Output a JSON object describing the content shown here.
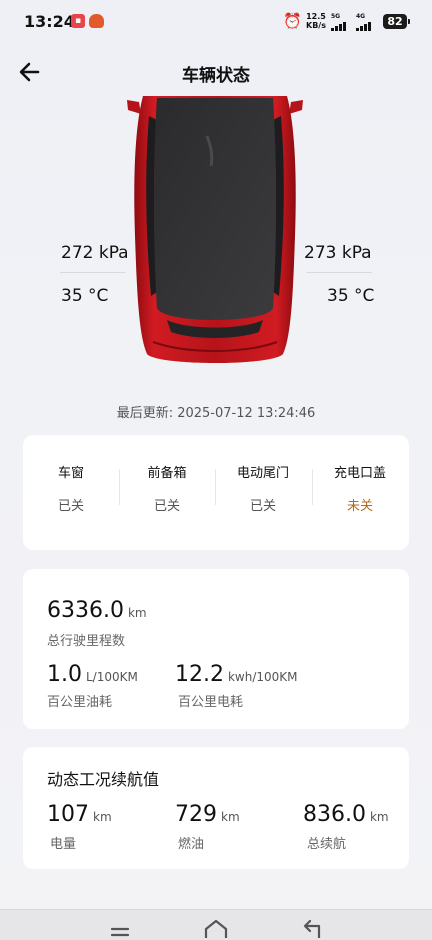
{
  "status_bar": {
    "time": "13:24",
    "net_speed_value": "12.5",
    "net_speed_unit": "KB/s",
    "signal1_label": "5G",
    "signal2_label": "4G",
    "battery": "82"
  },
  "header": {
    "title": "车辆状态"
  },
  "tires": {
    "left_pressure": "272 kPa",
    "left_temp": "35 °C",
    "right_pressure": "273 kPa",
    "right_temp": "35 °C"
  },
  "last_update": "最后更新:  2025-07-12 13:24:46",
  "status_items": [
    {
      "name": "车窗",
      "value": "已关"
    },
    {
      "name": "前备箱",
      "value": "已关"
    },
    {
      "name": "电动尾门",
      "value": "已关"
    },
    {
      "name": "充电口盖",
      "value": "未关"
    }
  ],
  "odometer": {
    "value": "6336.0",
    "unit": "km",
    "label": "总行驶里程数"
  },
  "consumption": {
    "fuel_value": "1.0",
    "fuel_unit": "L/100KM",
    "fuel_label": "百公里油耗",
    "elec_value": "12.2",
    "elec_unit": "kwh/100KM",
    "elec_label": "百公里电耗"
  },
  "range": {
    "title": "动态工况续航值",
    "items": [
      {
        "value": "107",
        "unit": "km",
        "label": "电量"
      },
      {
        "value": "729",
        "unit": "km",
        "label": "燃油"
      },
      {
        "value": "836.0",
        "unit": "km",
        "label": "总续航"
      }
    ]
  },
  "colors": {
    "accent_open": "#b8691f",
    "car_body": "#c8161d"
  },
  "icons": [
    "back-arrow-icon",
    "alarm-icon",
    "menu-icon",
    "home-icon",
    "return-icon"
  ]
}
